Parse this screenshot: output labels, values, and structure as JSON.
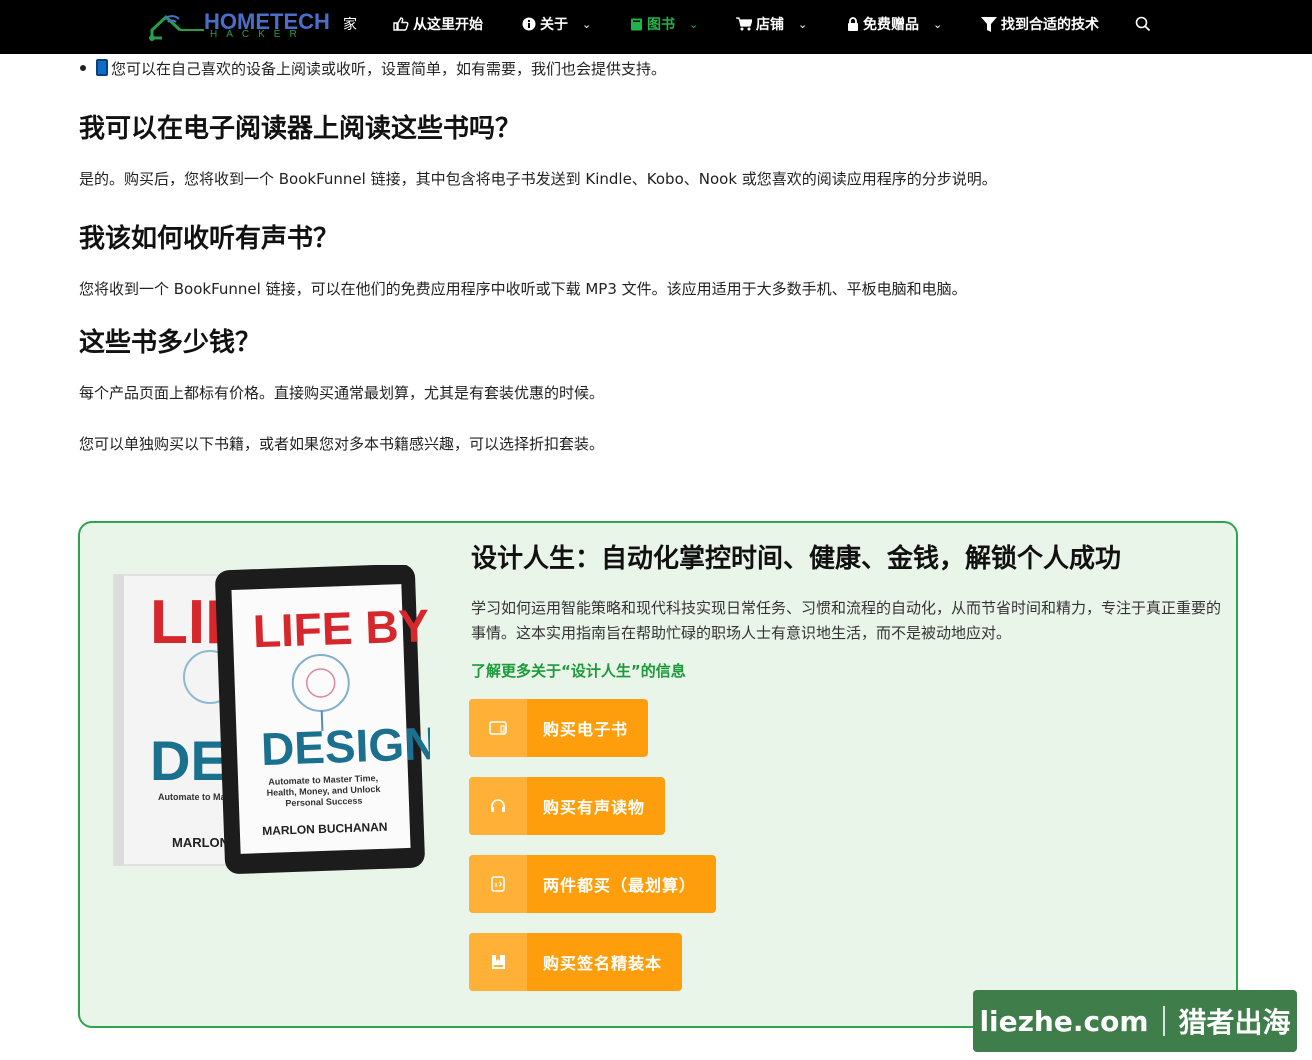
{
  "nav": {
    "logo": {
      "brand": "HOMETECH",
      "sub": "HACKER"
    },
    "items": [
      {
        "label": "家"
      },
      {
        "label": "从这里开始",
        "icon": "thumbs-up-icon"
      },
      {
        "label": "关于",
        "icon": "info-icon"
      },
      {
        "label": "图书",
        "icon": "book-icon"
      },
      {
        "label": "店铺",
        "icon": "cart-icon"
      },
      {
        "label": "免费赠品",
        "icon": "lock-icon"
      },
      {
        "label": "找到合适的技术",
        "icon": "filter-icon"
      }
    ],
    "chevron": "⌄"
  },
  "content": {
    "bullet_text": "您可以在自己喜欢的设备上阅读或收听，设置简单，如有需要，我们也会提供支持。",
    "faq": [
      {
        "q": "我可以在电子阅读器上阅读这些书吗？",
        "a": "是的。购买后，您将收到一个 BookFunnel 链接，其中包含将电子书发送到 Kindle、Kobo、Nook 或您喜欢的阅读应用程序的分步说明。"
      },
      {
        "q": "我该如何收听有声书？",
        "a": "您将收到一个 BookFunnel 链接，可以在他们的免费应用程序中收听或下载 MP3 文件。该应用适用于大多数手机、平板电脑和电脑。"
      },
      {
        "q": "这些书多少钱？",
        "a": "每个产品页面上都标有价格。直接购买通常最划算，尤其是有套装优惠的时候。"
      }
    ],
    "extra": "您可以单独购买以下书籍，或者如果您对多本书籍感兴趣，可以选择折扣套装。"
  },
  "product": {
    "title": "设计人生：自动化掌控时间、健康、金钱，解锁个人成功",
    "description": "学习如何运用智能策略和现代科技实现日常任务、习惯和流程的自动化，从而节省时间和精力，专注于真正重要的事情。这本实用指南旨在帮助忙碌的职场人士有意识地生活，而不是被动地应对。",
    "link": "了解更多关于“设计人生”的信息",
    "cover": {
      "back_title_1": "LIFE",
      "back_title_2": "DESI",
      "back_sub": "Automate to Ma Health, Money, a Personal Su",
      "back_author": "MARLON BUC",
      "front_title_1": "LIFE BY",
      "front_title_2": "DESIGN",
      "front_sub_1": "Automate to Master Time,",
      "front_sub_2": "Health, Money, and Unlock",
      "front_sub_3": "Personal Success",
      "front_author": "MARLON BUCHANAN"
    },
    "buttons": [
      {
        "label": "购买电子书",
        "icon": "tablet-icon"
      },
      {
        "label": "购买有声读物",
        "icon": "headphones-icon"
      },
      {
        "label": "两件都买（最划算）",
        "icon": "bundle-icon"
      },
      {
        "label": "购买签名精装本",
        "icon": "signed-book-icon"
      }
    ]
  },
  "watermark": {
    "left": "liezhe.com",
    "right": "猎者出海"
  },
  "colors": {
    "nav_bg": "#000000",
    "active": "#1fb34a",
    "button": "#ff9e0d",
    "box_border": "#2ea44f",
    "box_bg": "#eaf5ea"
  }
}
